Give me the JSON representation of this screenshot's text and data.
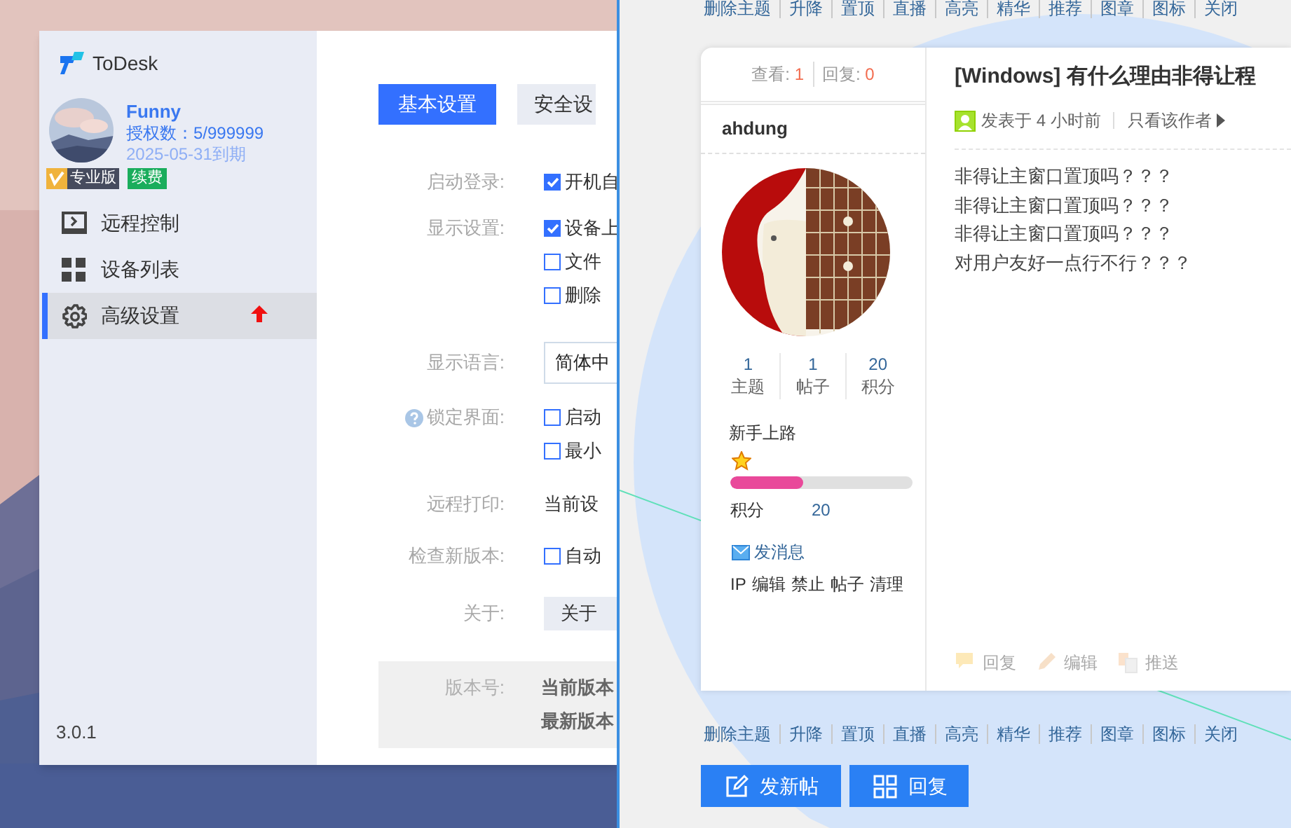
{
  "todesk": {
    "app_name": "ToDesk",
    "user": {
      "name": "Funny",
      "license": "授权数：5/999999",
      "expiry": "2025-05-31到期"
    },
    "badges": [
      {
        "kind": "edition",
        "label": "专业版"
      },
      {
        "kind": "renew",
        "label": "续费"
      }
    ],
    "nav": [
      {
        "label": "远程控制",
        "selected": false,
        "alert": false
      },
      {
        "label": "设备列表",
        "selected": false,
        "alert": false
      },
      {
        "label": "高级设置",
        "selected": true,
        "alert": true
      }
    ],
    "version": "3.0.1",
    "tabs": [
      {
        "label": "基本设置",
        "selected": true
      },
      {
        "label": "安全设",
        "selected": false
      }
    ],
    "settings": [
      {
        "label": "启动登录:",
        "help": false,
        "items": [
          {
            "kind": "checkbox",
            "text": "开机自",
            "checked": true
          }
        ]
      },
      {
        "label": "显示设置:",
        "help": false,
        "items": [
          {
            "kind": "checkbox",
            "text": "设备上",
            "checked": true
          },
          {
            "kind": "checkbox",
            "text": "文件",
            "checked": false
          },
          {
            "kind": "checkbox",
            "text": "删除",
            "checked": false
          }
        ]
      },
      {
        "label": "显示语言:",
        "help": false,
        "items": [
          {
            "kind": "select",
            "text": "简体中"
          }
        ]
      },
      {
        "label": "锁定界面:",
        "help": true,
        "items": [
          {
            "kind": "checkbox",
            "text": "启动",
            "checked": false
          },
          {
            "kind": "checkbox",
            "text": "最小",
            "checked": false
          }
        ]
      },
      {
        "label": "远程打印:",
        "help": false,
        "items": [
          {
            "kind": "text",
            "text": "当前设"
          }
        ]
      },
      {
        "label": "检查新版本:",
        "help": false,
        "items": [
          {
            "kind": "checkbox",
            "text": "自动",
            "checked": false
          }
        ]
      },
      {
        "label": "关于:",
        "help": false,
        "items": [
          {
            "kind": "button",
            "text": "关于"
          }
        ]
      }
    ],
    "version_info": {
      "label": "版本号:",
      "lines": [
        "当前版本",
        "最新版本"
      ]
    }
  },
  "forum": {
    "mod_links_top": [
      "删除主题",
      "升降",
      "置顶",
      "直播",
      "高亮",
      "精华",
      "推荐",
      "图章",
      "图标",
      "关闭"
    ],
    "post": {
      "views_label": "查看:",
      "views": "1",
      "replies_label": "回复:",
      "replies": "0",
      "author": "ahdung",
      "stats": [
        {
          "value": "1",
          "label": "主题"
        },
        {
          "value": "1",
          "label": "帖子"
        },
        {
          "value": "20",
          "label": "积分"
        }
      ],
      "rank": "新手上路",
      "level": 0.4,
      "points_label": "积分",
      "points": "20",
      "message_link": "发消息",
      "admin_links": [
        "IP",
        "编辑",
        "禁止",
        "帖子",
        "清理"
      ],
      "title": "[Windows] 有什么理由非得让程",
      "posted": "发表于 4 小时前",
      "author_only": "只看该作者",
      "body": [
        "非得让主窗口置顶吗？？？",
        "非得让主窗口置顶吗？？？",
        "非得让主窗口置顶吗？？？",
        "对用户友好一点行不行？？？"
      ],
      "actions": [
        "回复",
        "编辑",
        "推送"
      ]
    },
    "mod_links_bottom": [
      "删除主题",
      "升降",
      "置顶",
      "直播",
      "高亮",
      "精华",
      "推荐",
      "图章",
      "图标",
      "关闭"
    ],
    "buttons": [
      "发新帖",
      "回复"
    ]
  }
}
